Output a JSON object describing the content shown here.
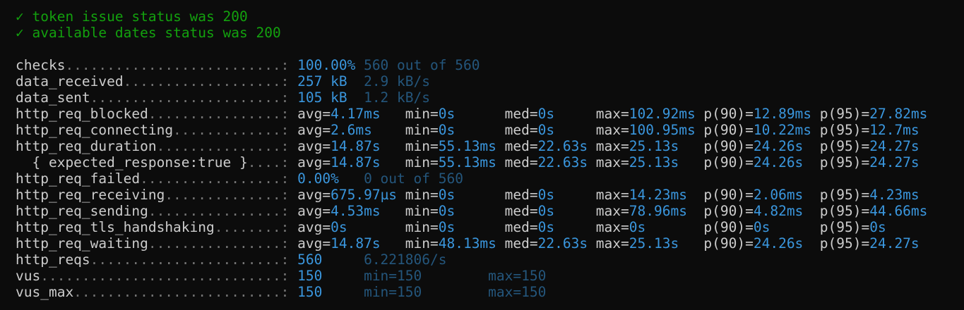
{
  "colors": {
    "background": "#0c0c0c",
    "text": "#cccccc",
    "pass": "#13a10e",
    "value": "#3a96dd",
    "secondary": "#24567c"
  },
  "checks": [
    {
      "icon": "check-mark-icon",
      "mark": "✓",
      "text": "token issue status was 200"
    },
    {
      "icon": "check-mark-icon",
      "mark": "✓",
      "text": "available dates status was 200"
    }
  ],
  "metrics": [
    {
      "name": "checks",
      "value": "100.00%",
      "secondary": [
        "560 out of 560"
      ]
    },
    {
      "name": "data_received",
      "value": "257 kB",
      "secondary": [
        "2.9 kB/s"
      ]
    },
    {
      "name": "data_sent",
      "value": "105 kB",
      "secondary": [
        "1.2 kB/s"
      ]
    },
    {
      "name": "http_req_blocked",
      "stats": [
        [
          "avg=",
          "4.17ms"
        ],
        [
          "min=",
          "0s"
        ],
        [
          "med=",
          "0s"
        ],
        [
          "max=",
          "102.92ms"
        ],
        [
          "p(90)=",
          "12.89ms"
        ],
        [
          "p(95)=",
          "27.82ms"
        ]
      ]
    },
    {
      "name": "http_req_connecting",
      "stats": [
        [
          "avg=",
          "2.6ms"
        ],
        [
          "min=",
          "0s"
        ],
        [
          "med=",
          "0s"
        ],
        [
          "max=",
          "100.95ms"
        ],
        [
          "p(90)=",
          "10.22ms"
        ],
        [
          "p(95)=",
          "12.7ms"
        ]
      ]
    },
    {
      "name": "http_req_duration",
      "stats": [
        [
          "avg=",
          "14.87s"
        ],
        [
          "min=",
          "55.13ms"
        ],
        [
          "med=",
          "22.63s"
        ],
        [
          "max=",
          "25.13s"
        ],
        [
          "p(90)=",
          "24.26s"
        ],
        [
          "p(95)=",
          "24.27s"
        ]
      ]
    },
    {
      "name": "  { expected_response:true }",
      "stats": [
        [
          "avg=",
          "14.87s"
        ],
        [
          "min=",
          "55.13ms"
        ],
        [
          "med=",
          "22.63s"
        ],
        [
          "max=",
          "25.13s"
        ],
        [
          "p(90)=",
          "24.26s"
        ],
        [
          "p(95)=",
          "24.27s"
        ]
      ]
    },
    {
      "name": "http_req_failed",
      "value": "0.00%",
      "secondary": [
        "0 out of 560"
      ]
    },
    {
      "name": "http_req_receiving",
      "stats": [
        [
          "avg=",
          "675.97µs"
        ],
        [
          "min=",
          "0s"
        ],
        [
          "med=",
          "0s"
        ],
        [
          "max=",
          "14.23ms"
        ],
        [
          "p(90)=",
          "2.06ms"
        ],
        [
          "p(95)=",
          "4.23ms"
        ]
      ]
    },
    {
      "name": "http_req_sending",
      "stats": [
        [
          "avg=",
          "4.53ms"
        ],
        [
          "min=",
          "0s"
        ],
        [
          "med=",
          "0s"
        ],
        [
          "max=",
          "78.96ms"
        ],
        [
          "p(90)=",
          "4.82ms"
        ],
        [
          "p(95)=",
          "44.66ms"
        ]
      ]
    },
    {
      "name": "http_req_tls_handshaking",
      "stats": [
        [
          "avg=",
          "0s"
        ],
        [
          "min=",
          "0s"
        ],
        [
          "med=",
          "0s"
        ],
        [
          "max=",
          "0s"
        ],
        [
          "p(90)=",
          "0s"
        ],
        [
          "p(95)=",
          "0s"
        ]
      ]
    },
    {
      "name": "http_req_waiting",
      "stats": [
        [
          "avg=",
          "14.87s"
        ],
        [
          "min=",
          "48.13ms"
        ],
        [
          "med=",
          "22.63s"
        ],
        [
          "max=",
          "25.13s"
        ],
        [
          "p(90)=",
          "24.26s"
        ],
        [
          "p(95)=",
          "24.27s"
        ]
      ]
    },
    {
      "name": "http_reqs",
      "value": "560",
      "secondary": [
        "6.221806/s"
      ]
    },
    {
      "name": "vus",
      "value": "150",
      "secondary": [
        "min=150",
        "max=150"
      ]
    },
    {
      "name": "vus_max",
      "value": "150",
      "secondary": [
        "min=150",
        "max=150"
      ]
    }
  ]
}
